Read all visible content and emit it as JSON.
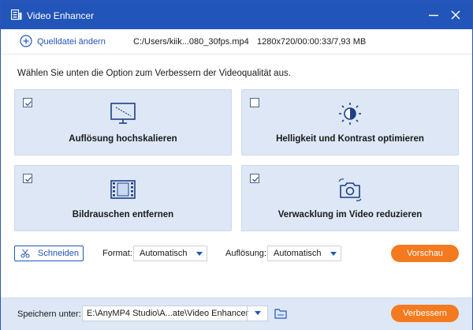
{
  "window": {
    "title": "Video Enhancer",
    "accent_color": "#2255b9",
    "button_color": "#f47a1f"
  },
  "source": {
    "add_label": "Quelldatei ändern",
    "file_path": "C:/Users/kiik...080_30fps.mp4",
    "file_info": "1280x720/00:00:33/7,93 MB"
  },
  "instruction": "Wählen Sie unten die Option zum Verbessern der Videoqualität aus.",
  "options": [
    {
      "label": "Auflösung hochskalieren",
      "checked": true,
      "icon": "monitor-icon"
    },
    {
      "label": "Helligkeit und Kontrast optimieren",
      "checked": false,
      "icon": "brightness-icon"
    },
    {
      "label": "Bildrauschen entfernen",
      "checked": true,
      "icon": "film-icon"
    },
    {
      "label": "Verwacklung im Video reduzieren",
      "checked": true,
      "icon": "camera-shake-icon"
    }
  ],
  "toolbar": {
    "cut_label": "Schneiden",
    "format_label": "Format:",
    "format_value": "Automatisch",
    "resolution_label": "Auflösung:",
    "resolution_value": "Automatisch",
    "preview_label": "Vorschau"
  },
  "footer": {
    "save_label": "Speichern unter:",
    "save_path": "E:\\AnyMP4 Studio\\A...ate\\Video Enhancer",
    "enhance_label": "Verbessern"
  }
}
